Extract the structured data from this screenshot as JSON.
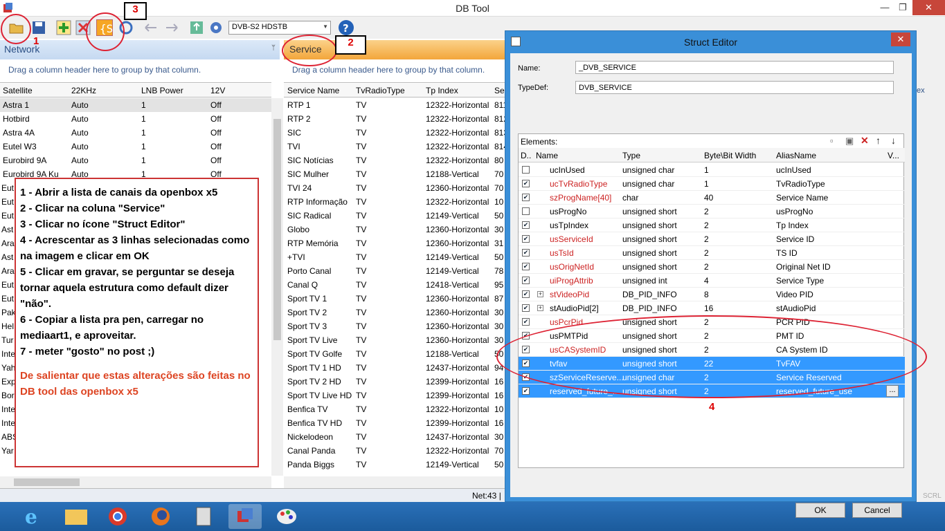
{
  "app": {
    "title": "DB Tool"
  },
  "window_controls": {
    "minimize": "—",
    "maximize": "❐",
    "close": "✕"
  },
  "toolbar": {
    "combo_value": "DVB-S2 HDSTB"
  },
  "annotations": {
    "n1": "1",
    "n2": "2",
    "n3": "3",
    "n4": "4"
  },
  "network": {
    "title": "Network",
    "group_hint": "Drag a column header here to group by that column.",
    "columns": [
      "Satellite",
      "22KHz",
      "LNB Power",
      "12V"
    ],
    "rows": [
      [
        "Astra 1",
        "Auto",
        "1",
        "Off"
      ],
      [
        "Hotbird",
        "Auto",
        "1",
        "Off"
      ],
      [
        "Astra 4A",
        "Auto",
        "1",
        "Off"
      ],
      [
        "Eutel W3",
        "Auto",
        "1",
        "Off"
      ],
      [
        "Eurobird 9A",
        "Auto",
        "1",
        "Off"
      ],
      [
        "Eurobird 9A Ku",
        "Auto",
        "1",
        "Off"
      ]
    ],
    "peek": [
      "Eut",
      "Eut",
      "Eut",
      "Ast",
      "Ara",
      "Ast",
      "Ara",
      "Eut",
      "Eut",
      "Pak",
      "Hel",
      "Tur",
      "Inte",
      "Yah",
      "Exp",
      "Bor",
      "Inte",
      "Inte",
      "ABS",
      "Yar"
    ]
  },
  "note": {
    "lines": [
      "1 - Abrir a lista de canais da openbox x5",
      "2 - Clicar na coluna \"Service\"",
      "3 - Clicar no ícone \"Struct Editor\"",
      "4 - Acrescentar as 3 linhas selecionadas como na imagem e clicar em OK",
      "5 - Clicar em gravar, se perguntar se deseja tornar aquela estrutura como default dizer \"não\".",
      "6 - Copiar a lista pra pen, carregar no mediaart1, e aproveitar.",
      "7 - meter \"gosto\" no post ;)"
    ],
    "warning": "De salientar que estas alterações são feitas no DB tool das openbox x5"
  },
  "service": {
    "title": "Service",
    "group_hint": "Drag a column header here to group by that column.",
    "columns": [
      "Service Name",
      "TvRadioType",
      "Tp Index",
      "Se"
    ],
    "rows": [
      [
        "RTP 1",
        "TV",
        "12322-Horizontal",
        "811"
      ],
      [
        "RTP 2",
        "TV",
        "12322-Horizontal",
        "812"
      ],
      [
        "SIC",
        "TV",
        "12322-Horizontal",
        "813"
      ],
      [
        "TVI",
        "TV",
        "12322-Horizontal",
        "814"
      ],
      [
        "SIC Notícias",
        "TV",
        "12322-Horizontal",
        "80"
      ],
      [
        "SIC Mulher",
        "TV",
        "12188-Vertical",
        "70"
      ],
      [
        "TVI 24",
        "TV",
        "12360-Horizontal",
        "70"
      ],
      [
        "RTP Informação",
        "TV",
        "12322-Horizontal",
        "10"
      ],
      [
        "SIC Radical",
        "TV",
        "12149-Vertical",
        "50"
      ],
      [
        "Globo",
        "TV",
        "12360-Horizontal",
        "30"
      ],
      [
        "RTP Memória",
        "TV",
        "12360-Horizontal",
        "31"
      ],
      [
        "+TVI",
        "TV",
        "12149-Vertical",
        "50"
      ],
      [
        "Porto Canal",
        "TV",
        "12149-Vertical",
        "78"
      ],
      [
        "Canal Q",
        "TV",
        "12418-Vertical",
        "95"
      ],
      [
        "Sport TV 1",
        "TV",
        "12360-Horizontal",
        "87"
      ],
      [
        "Sport TV 2",
        "TV",
        "12360-Horizontal",
        "30"
      ],
      [
        "Sport TV 3",
        "TV",
        "12360-Horizontal",
        "30"
      ],
      [
        "Sport TV Live",
        "TV",
        "12360-Horizontal",
        "30"
      ],
      [
        "Sport TV Golfe",
        "TV",
        "12188-Vertical",
        "50"
      ],
      [
        "Sport TV 1 HD",
        "TV",
        "12437-Horizontal",
        "94"
      ],
      [
        "Sport TV 2 HD",
        "TV",
        "12399-Horizontal",
        "16"
      ],
      [
        "Sport TV Live HD",
        "TV",
        "12399-Horizontal",
        "16"
      ],
      [
        "Benfica TV",
        "TV",
        "12322-Horizontal",
        "10"
      ],
      [
        "Benfica TV HD",
        "TV",
        "12399-Horizontal",
        "16"
      ],
      [
        "Nickelodeon",
        "TV",
        "12437-Horizontal",
        "30"
      ],
      [
        "Canal Panda",
        "TV",
        "12322-Horizontal",
        "70"
      ],
      [
        "Panda Biggs",
        "TV",
        "12149-Vertical",
        "50"
      ]
    ]
  },
  "status": {
    "net": "Net:43 |"
  },
  "right_peek": {
    "col": "ex",
    "scrl": "SCRL"
  },
  "dialog": {
    "title": "Struct Editor",
    "name_label": "Name:",
    "name_value": "_DVB_SERVICE",
    "typedef_label": "TypeDef:",
    "typedef_value": "DVB_SERVICE",
    "elements_label": "Elements:",
    "columns": [
      "D..",
      "Name",
      "Type",
      "Byte\\Bit Width",
      "AliasName",
      "V..."
    ],
    "rows": [
      {
        "checked": false,
        "name": "ucInUsed",
        "type": "unsigned char",
        "width": "1",
        "alias": "ucInUsed",
        "red": false,
        "hl": false
      },
      {
        "checked": true,
        "name": "ucTvRadioType",
        "type": "unsigned char",
        "width": "1",
        "alias": "TvRadioType",
        "red": true,
        "hl": false
      },
      {
        "checked": true,
        "name": "szProgName[40]",
        "type": "char",
        "width": "40",
        "alias": "Service Name",
        "red": true,
        "hl": false
      },
      {
        "checked": false,
        "name": "usProgNo",
        "type": "unsigned short",
        "width": "2",
        "alias": "usProgNo",
        "red": false,
        "hl": false
      },
      {
        "checked": true,
        "name": "usTpIndex",
        "type": "unsigned short",
        "width": "2",
        "alias": "Tp Index",
        "red": false,
        "hl": false
      },
      {
        "checked": true,
        "name": "usServiceId",
        "type": "unsigned short",
        "width": "2",
        "alias": "Service ID",
        "red": true,
        "hl": false
      },
      {
        "checked": true,
        "name": "usTsId",
        "type": "unsigned short",
        "width": "2",
        "alias": "TS ID",
        "red": true,
        "hl": false
      },
      {
        "checked": true,
        "name": "usOrigNetId",
        "type": "unsigned short",
        "width": "2",
        "alias": "Original Net ID",
        "red": true,
        "hl": false
      },
      {
        "checked": true,
        "name": "uiProgAttrib",
        "type": "unsigned int",
        "width": "4",
        "alias": "Service Type",
        "red": true,
        "hl": false
      },
      {
        "checked": true,
        "name": "stVideoPid",
        "type": "DB_PID_INFO",
        "width": "8",
        "alias": "Video PID",
        "red": true,
        "hl": false,
        "expand": true
      },
      {
        "checked": true,
        "name": "stAudioPid[2]",
        "type": "DB_PID_INFO",
        "width": "16",
        "alias": "stAudioPid",
        "red": false,
        "hl": false,
        "expand": true
      },
      {
        "checked": true,
        "name": "usPcrPid",
        "type": "unsigned short",
        "width": "2",
        "alias": "PCR PID",
        "red": true,
        "hl": false
      },
      {
        "checked": true,
        "name": "usPMTPid",
        "type": "unsigned short",
        "width": "2",
        "alias": "PMT ID",
        "red": false,
        "hl": false
      },
      {
        "checked": true,
        "name": "usCASystemID",
        "type": "unsigned short",
        "width": "2",
        "alias": "CA System ID",
        "red": true,
        "hl": false
      },
      {
        "checked": true,
        "name": "tvfav",
        "type": "unsigned short",
        "width": "22",
        "alias": "TvFAV",
        "red": false,
        "hl": true
      },
      {
        "checked": true,
        "name": "szServiceReserve...",
        "type": "unsigned char",
        "width": "2",
        "alias": "Service Reserved",
        "red": false,
        "hl": true
      },
      {
        "checked": true,
        "name": "reserved_future_...",
        "type": "unsigned short",
        "width": "2",
        "alias": "reserved_future_use",
        "red": false,
        "hl": true,
        "ellipsis": "..."
      }
    ],
    "ok": "OK",
    "cancel": "Cancel"
  }
}
